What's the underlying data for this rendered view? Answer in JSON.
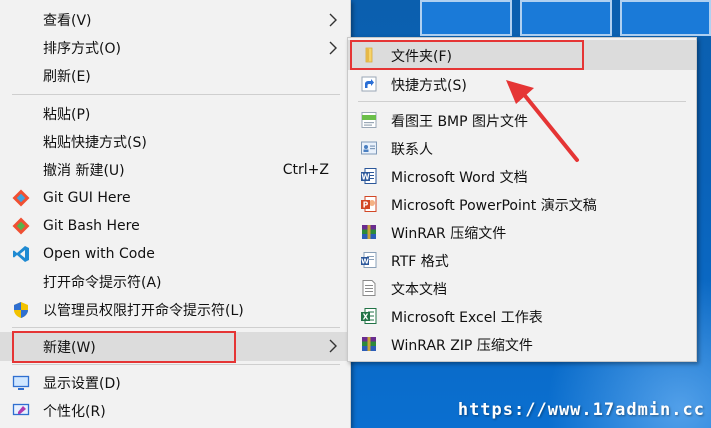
{
  "main_menu": {
    "items": [
      {
        "label": "查看(V)"
      },
      {
        "label": "排序方式(O)"
      },
      {
        "label": "刷新(E)"
      },
      {
        "label": "粘贴(P)"
      },
      {
        "label": "粘贴快捷方式(S)"
      },
      {
        "label": "撤消 新建(U)",
        "shortcut": "Ctrl+Z"
      },
      {
        "label": "Git GUI Here"
      },
      {
        "label": "Git Bash Here"
      },
      {
        "label": "Open with Code"
      },
      {
        "label": "打开命令提示符(A)"
      },
      {
        "label": "以管理员权限打开命令提示符(L)"
      },
      {
        "label": "新建(W)"
      },
      {
        "label": "显示设置(D)"
      },
      {
        "label": "个性化(R)"
      }
    ]
  },
  "submenu": {
    "items": [
      {
        "label": "文件夹(F)",
        "icon": "folder-icon"
      },
      {
        "label": "快捷方式(S)",
        "icon": "shortcut-icon"
      },
      {
        "label": "看图王 BMP 图片文件",
        "icon": "bmp-image-icon"
      },
      {
        "label": "联系人",
        "icon": "contact-icon"
      },
      {
        "label": "Microsoft Word 文档",
        "icon": "word-icon"
      },
      {
        "label": "Microsoft PowerPoint 演示文稿",
        "icon": "powerpoint-icon"
      },
      {
        "label": "WinRAR 压缩文件",
        "icon": "winrar-icon"
      },
      {
        "label": "RTF 格式",
        "icon": "rtf-icon"
      },
      {
        "label": "文本文档",
        "icon": "text-document-icon"
      },
      {
        "label": "Microsoft Excel 工作表",
        "icon": "excel-icon"
      },
      {
        "label": "WinRAR ZIP 压缩文件",
        "icon": "winrar-zip-icon"
      }
    ]
  },
  "watermark": "https://www.17admin.cc",
  "colors": {
    "menu_bg": "#f2f2f2",
    "highlight": "#dcdcdc",
    "annotation_red": "#e53535",
    "desktop_blue": "#0a62b8"
  }
}
